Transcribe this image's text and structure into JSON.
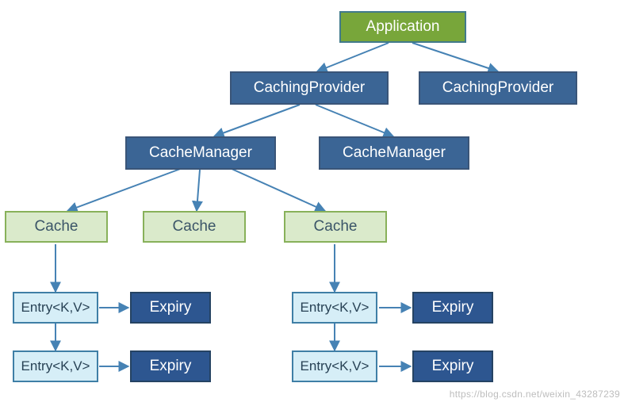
{
  "nodes": {
    "application": "Application",
    "cachingProvider1": "CachingProvider",
    "cachingProvider2": "CachingProvider",
    "cacheManager1": "CacheManager",
    "cacheManager2": "CacheManager",
    "cache1": "Cache",
    "cache2": "Cache",
    "cache3": "Cache",
    "entry1a": "Entry<K,V>",
    "entry1b": "Entry<K,V>",
    "entry3a": "Entry<K,V>",
    "entry3b": "Entry<K,V>",
    "expiry1a": "Expiry",
    "expiry1b": "Expiry",
    "expiry3a": "Expiry",
    "expiry3b": "Expiry"
  },
  "watermark": "https://blog.csdn.net/weixin_43287239",
  "colors": {
    "rootFill": "#78a63a",
    "darkBlueFill": "#3b6595",
    "cacheFill": "#daeacb",
    "entryFill": "#d6eef7",
    "expiryFill": "#2d5690",
    "arrow": "#4682b4"
  },
  "edges": [
    [
      "application",
      "cachingProvider1"
    ],
    [
      "application",
      "cachingProvider2"
    ],
    [
      "cachingProvider1",
      "cacheManager1"
    ],
    [
      "cachingProvider1",
      "cacheManager2"
    ],
    [
      "cacheManager1",
      "cache1"
    ],
    [
      "cacheManager1",
      "cache2"
    ],
    [
      "cacheManager1",
      "cache3"
    ],
    [
      "cache1",
      "entry1a"
    ],
    [
      "entry1a",
      "entry1b"
    ],
    [
      "entry1a",
      "expiry1a"
    ],
    [
      "entry1b",
      "expiry1b"
    ],
    [
      "cache3",
      "entry3a"
    ],
    [
      "entry3a",
      "entry3b"
    ],
    [
      "entry3a",
      "expiry3a"
    ],
    [
      "entry3b",
      "expiry3b"
    ]
  ]
}
